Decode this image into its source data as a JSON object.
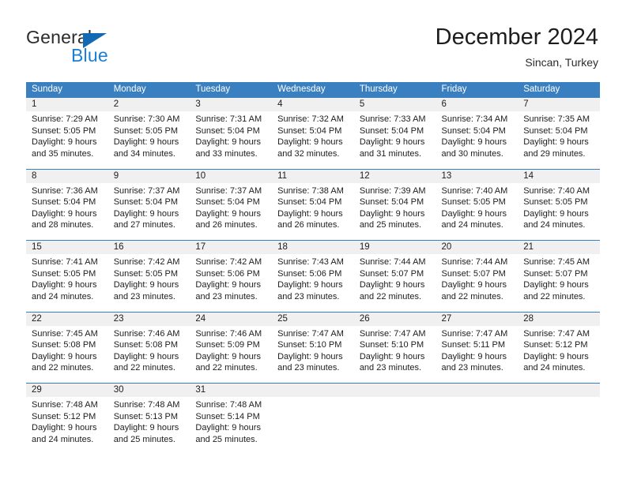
{
  "brand": {
    "general": "General",
    "blue": "Blue",
    "triangle_color": "#1469b4",
    "blue_color": "#1a7fd4"
  },
  "header": {
    "title": "December 2024",
    "location": "Sincan, Turkey"
  },
  "theme": {
    "header_bg": "#3a80c1",
    "daynum_bg": "#f0f0f0",
    "text": "#1d1d1d"
  },
  "weekdays": [
    "Sunday",
    "Monday",
    "Tuesday",
    "Wednesday",
    "Thursday",
    "Friday",
    "Saturday"
  ],
  "weeks": [
    {
      "days": [
        {
          "num": "1",
          "sunrise": "Sunrise: 7:29 AM",
          "sunset": "Sunset: 5:05 PM",
          "daylight1": "Daylight: 9 hours",
          "daylight2": "and 35 minutes."
        },
        {
          "num": "2",
          "sunrise": "Sunrise: 7:30 AM",
          "sunset": "Sunset: 5:05 PM",
          "daylight1": "Daylight: 9 hours",
          "daylight2": "and 34 minutes."
        },
        {
          "num": "3",
          "sunrise": "Sunrise: 7:31 AM",
          "sunset": "Sunset: 5:04 PM",
          "daylight1": "Daylight: 9 hours",
          "daylight2": "and 33 minutes."
        },
        {
          "num": "4",
          "sunrise": "Sunrise: 7:32 AM",
          "sunset": "Sunset: 5:04 PM",
          "daylight1": "Daylight: 9 hours",
          "daylight2": "and 32 minutes."
        },
        {
          "num": "5",
          "sunrise": "Sunrise: 7:33 AM",
          "sunset": "Sunset: 5:04 PM",
          "daylight1": "Daylight: 9 hours",
          "daylight2": "and 31 minutes."
        },
        {
          "num": "6",
          "sunrise": "Sunrise: 7:34 AM",
          "sunset": "Sunset: 5:04 PM",
          "daylight1": "Daylight: 9 hours",
          "daylight2": "and 30 minutes."
        },
        {
          "num": "7",
          "sunrise": "Sunrise: 7:35 AM",
          "sunset": "Sunset: 5:04 PM",
          "daylight1": "Daylight: 9 hours",
          "daylight2": "and 29 minutes."
        }
      ]
    },
    {
      "days": [
        {
          "num": "8",
          "sunrise": "Sunrise: 7:36 AM",
          "sunset": "Sunset: 5:04 PM",
          "daylight1": "Daylight: 9 hours",
          "daylight2": "and 28 minutes."
        },
        {
          "num": "9",
          "sunrise": "Sunrise: 7:37 AM",
          "sunset": "Sunset: 5:04 PM",
          "daylight1": "Daylight: 9 hours",
          "daylight2": "and 27 minutes."
        },
        {
          "num": "10",
          "sunrise": "Sunrise: 7:37 AM",
          "sunset": "Sunset: 5:04 PM",
          "daylight1": "Daylight: 9 hours",
          "daylight2": "and 26 minutes."
        },
        {
          "num": "11",
          "sunrise": "Sunrise: 7:38 AM",
          "sunset": "Sunset: 5:04 PM",
          "daylight1": "Daylight: 9 hours",
          "daylight2": "and 26 minutes."
        },
        {
          "num": "12",
          "sunrise": "Sunrise: 7:39 AM",
          "sunset": "Sunset: 5:04 PM",
          "daylight1": "Daylight: 9 hours",
          "daylight2": "and 25 minutes."
        },
        {
          "num": "13",
          "sunrise": "Sunrise: 7:40 AM",
          "sunset": "Sunset: 5:05 PM",
          "daylight1": "Daylight: 9 hours",
          "daylight2": "and 24 minutes."
        },
        {
          "num": "14",
          "sunrise": "Sunrise: 7:40 AM",
          "sunset": "Sunset: 5:05 PM",
          "daylight1": "Daylight: 9 hours",
          "daylight2": "and 24 minutes."
        }
      ]
    },
    {
      "days": [
        {
          "num": "15",
          "sunrise": "Sunrise: 7:41 AM",
          "sunset": "Sunset: 5:05 PM",
          "daylight1": "Daylight: 9 hours",
          "daylight2": "and 24 minutes."
        },
        {
          "num": "16",
          "sunrise": "Sunrise: 7:42 AM",
          "sunset": "Sunset: 5:05 PM",
          "daylight1": "Daylight: 9 hours",
          "daylight2": "and 23 minutes."
        },
        {
          "num": "17",
          "sunrise": "Sunrise: 7:42 AM",
          "sunset": "Sunset: 5:06 PM",
          "daylight1": "Daylight: 9 hours",
          "daylight2": "and 23 minutes."
        },
        {
          "num": "18",
          "sunrise": "Sunrise: 7:43 AM",
          "sunset": "Sunset: 5:06 PM",
          "daylight1": "Daylight: 9 hours",
          "daylight2": "and 23 minutes."
        },
        {
          "num": "19",
          "sunrise": "Sunrise: 7:44 AM",
          "sunset": "Sunset: 5:07 PM",
          "daylight1": "Daylight: 9 hours",
          "daylight2": "and 22 minutes."
        },
        {
          "num": "20",
          "sunrise": "Sunrise: 7:44 AM",
          "sunset": "Sunset: 5:07 PM",
          "daylight1": "Daylight: 9 hours",
          "daylight2": "and 22 minutes."
        },
        {
          "num": "21",
          "sunrise": "Sunrise: 7:45 AM",
          "sunset": "Sunset: 5:07 PM",
          "daylight1": "Daylight: 9 hours",
          "daylight2": "and 22 minutes."
        }
      ]
    },
    {
      "days": [
        {
          "num": "22",
          "sunrise": "Sunrise: 7:45 AM",
          "sunset": "Sunset: 5:08 PM",
          "daylight1": "Daylight: 9 hours",
          "daylight2": "and 22 minutes."
        },
        {
          "num": "23",
          "sunrise": "Sunrise: 7:46 AM",
          "sunset": "Sunset: 5:08 PM",
          "daylight1": "Daylight: 9 hours",
          "daylight2": "and 22 minutes."
        },
        {
          "num": "24",
          "sunrise": "Sunrise: 7:46 AM",
          "sunset": "Sunset: 5:09 PM",
          "daylight1": "Daylight: 9 hours",
          "daylight2": "and 22 minutes."
        },
        {
          "num": "25",
          "sunrise": "Sunrise: 7:47 AM",
          "sunset": "Sunset: 5:10 PM",
          "daylight1": "Daylight: 9 hours",
          "daylight2": "and 23 minutes."
        },
        {
          "num": "26",
          "sunrise": "Sunrise: 7:47 AM",
          "sunset": "Sunset: 5:10 PM",
          "daylight1": "Daylight: 9 hours",
          "daylight2": "and 23 minutes."
        },
        {
          "num": "27",
          "sunrise": "Sunrise: 7:47 AM",
          "sunset": "Sunset: 5:11 PM",
          "daylight1": "Daylight: 9 hours",
          "daylight2": "and 23 minutes."
        },
        {
          "num": "28",
          "sunrise": "Sunrise: 7:47 AM",
          "sunset": "Sunset: 5:12 PM",
          "daylight1": "Daylight: 9 hours",
          "daylight2": "and 24 minutes."
        }
      ]
    },
    {
      "days": [
        {
          "num": "29",
          "sunrise": "Sunrise: 7:48 AM",
          "sunset": "Sunset: 5:12 PM",
          "daylight1": "Daylight: 9 hours",
          "daylight2": "and 24 minutes."
        },
        {
          "num": "30",
          "sunrise": "Sunrise: 7:48 AM",
          "sunset": "Sunset: 5:13 PM",
          "daylight1": "Daylight: 9 hours",
          "daylight2": "and 25 minutes."
        },
        {
          "num": "31",
          "sunrise": "Sunrise: 7:48 AM",
          "sunset": "Sunset: 5:14 PM",
          "daylight1": "Daylight: 9 hours",
          "daylight2": "and 25 minutes."
        },
        {
          "num": "",
          "sunrise": "",
          "sunset": "",
          "daylight1": "",
          "daylight2": ""
        },
        {
          "num": "",
          "sunrise": "",
          "sunset": "",
          "daylight1": "",
          "daylight2": ""
        },
        {
          "num": "",
          "sunrise": "",
          "sunset": "",
          "daylight1": "",
          "daylight2": ""
        },
        {
          "num": "",
          "sunrise": "",
          "sunset": "",
          "daylight1": "",
          "daylight2": ""
        }
      ]
    }
  ]
}
